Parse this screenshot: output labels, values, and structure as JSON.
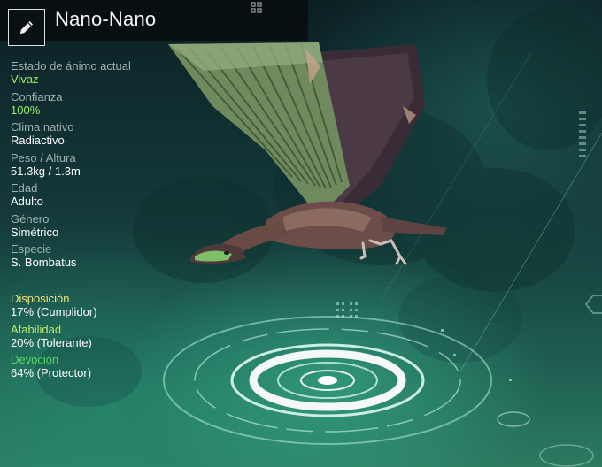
{
  "header": {
    "title": "Nano-Nano",
    "edit_icon": "pencil-icon"
  },
  "stats": [
    {
      "label": "Estado de ánimo actual",
      "value": "Vivaz",
      "highlight": true
    },
    {
      "label": "Confianza",
      "value": "100%",
      "highlight": true
    },
    {
      "label": "Clima nativo",
      "value": "Radiactivo",
      "highlight": false
    },
    {
      "label": "Peso / Altura",
      "value": "51.3kg / 1.3m",
      "highlight": false
    },
    {
      "label": "Edad",
      "value": "Adulto",
      "highlight": false
    },
    {
      "label": "Género",
      "value": "Simétrico",
      "highlight": false
    },
    {
      "label": "Especie",
      "value": "S. Bombatus",
      "highlight": false
    }
  ],
  "traits": [
    {
      "label": "Disposición",
      "value": "17% (Cumplidor)",
      "color": "#f2e37a"
    },
    {
      "label": "Afabilidad",
      "value": "20% (Tolerante)",
      "color": "#b9ea6c"
    },
    {
      "label": "Devoción",
      "value": "64% (Protector)",
      "color": "#55d85f"
    }
  ],
  "colors": {
    "highlight_value": "#9bf06a",
    "label": "#9fb0b0",
    "value": "#ffffff"
  }
}
